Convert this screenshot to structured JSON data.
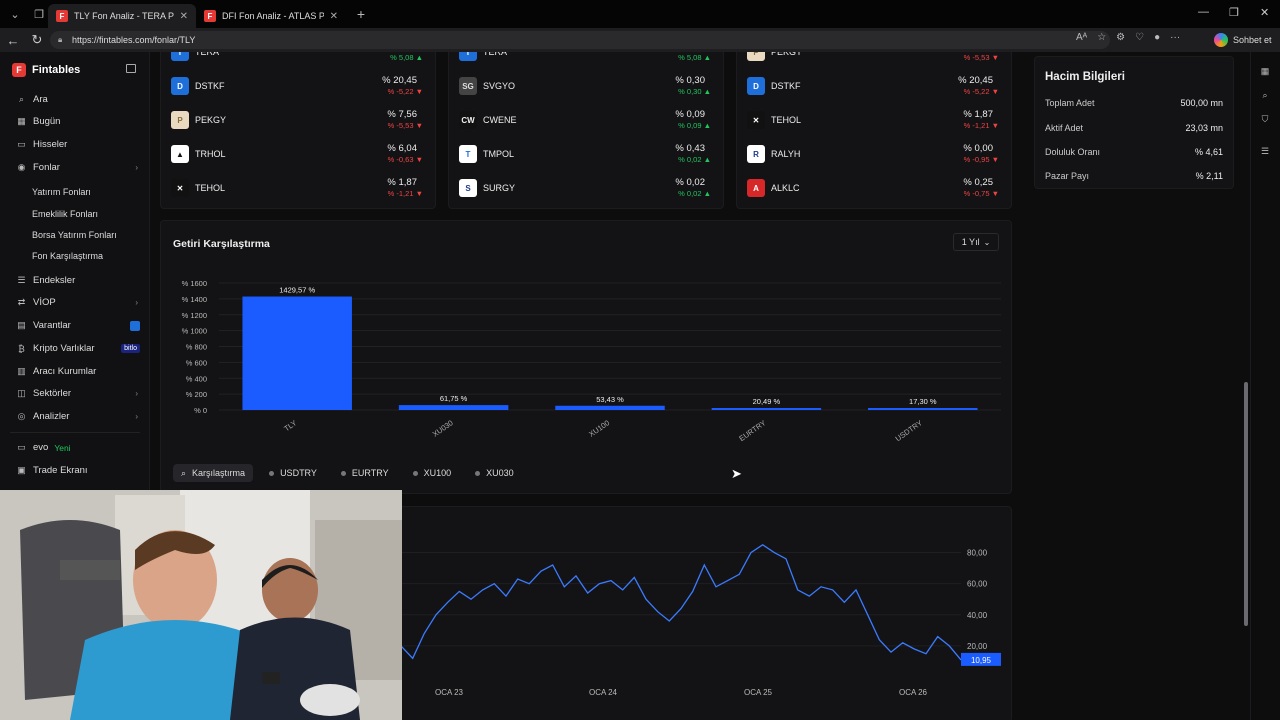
{
  "browser": {
    "tabs": [
      {
        "label": "TLY Fon Analiz - TERA PORTFÖY B"
      },
      {
        "label": "DFI Fon Analiz - ATLAS PORTFÖY"
      }
    ],
    "url": "https://fintables.com/fonlar/TLY",
    "copilot_label": "Sohbet et"
  },
  "sidebar": {
    "brand": "Fintables",
    "items": [
      {
        "label": "Ara"
      },
      {
        "label": "Bugün"
      },
      {
        "label": "Hisseler"
      },
      {
        "label": "Fonlar"
      },
      {
        "label": "Endeksler"
      },
      {
        "label": "VİOP"
      },
      {
        "label": "Varantlar"
      },
      {
        "label": "Kripto Varlıklar",
        "badge": "bitlo"
      },
      {
        "label": "Aracı Kurumlar"
      },
      {
        "label": "Sektörler"
      },
      {
        "label": "Analizler"
      },
      {
        "label": "evo",
        "badge": "Yeni"
      },
      {
        "label": "Trade Ekranı"
      }
    ],
    "fon_subitems": [
      "Yatırım Fonları",
      "Emeklilik Fonları",
      "Borsa Yatırım Fonları",
      "Fon Karşılaştırma"
    ]
  },
  "holdings": {
    "col1": [
      {
        "ticker": "TERA",
        "value": "",
        "change": "% 5,08",
        "dir": "up"
      },
      {
        "ticker": "DSTKF",
        "value": "% 20,45",
        "change": "% -5,22",
        "dir": "dn"
      },
      {
        "ticker": "PEKGY",
        "value": "% 7,56",
        "change": "% -5,53",
        "dir": "dn"
      },
      {
        "ticker": "TRHOL",
        "value": "% 6,04",
        "change": "% -0,63",
        "dir": "dn"
      },
      {
        "ticker": "TEHOL",
        "value": "% 1,87",
        "change": "% -1,21",
        "dir": "dn"
      }
    ],
    "col2": [
      {
        "ticker": "TERA",
        "value": "",
        "change": "% 5,08",
        "dir": "up"
      },
      {
        "ticker": "SVGYO",
        "value": "% 0,30",
        "change": "% 0,30",
        "dir": "up"
      },
      {
        "ticker": "CWENE",
        "value": "% 0,09",
        "change": "% 0,09",
        "dir": "up"
      },
      {
        "ticker": "TMPOL",
        "value": "% 0,43",
        "change": "% 0,02",
        "dir": "up"
      },
      {
        "ticker": "SURGY",
        "value": "% 0,02",
        "change": "% 0,02",
        "dir": "up"
      }
    ],
    "col3": [
      {
        "ticker": "PEKGY",
        "value": "",
        "change": "% -5,53",
        "dir": "dn"
      },
      {
        "ticker": "DSTKF",
        "value": "% 20,45",
        "change": "% -5,22",
        "dir": "dn"
      },
      {
        "ticker": "TEHOL",
        "value": "% 1,87",
        "change": "% -1,21",
        "dir": "dn"
      },
      {
        "ticker": "RALYH",
        "value": "% 0,00",
        "change": "% -0,95",
        "dir": "dn"
      },
      {
        "ticker": "ALKLC",
        "value": "% 0,25",
        "change": "% -0,75",
        "dir": "dn"
      }
    ]
  },
  "hacim": {
    "title": "Hacim Bilgileri",
    "rows": [
      {
        "label": "Toplam Adet",
        "value": "500,00 mn"
      },
      {
        "label": "Aktif Adet",
        "value": "23,03 mn"
      },
      {
        "label": "Doluluk Oranı",
        "value": "% 4,61"
      },
      {
        "label": "Pazar Payı",
        "value": "% 2,11"
      }
    ]
  },
  "getiri": {
    "title": "Getiri Karşılaştırma",
    "period": "1 Yıl",
    "compare_label": "Karşılaştırma",
    "compare_chips": [
      "USDTRY",
      "EURTRY",
      "XU100",
      "XU030"
    ]
  },
  "chart_data": [
    {
      "type": "bar",
      "title": "Getiri Karşılaştırma",
      "categories": [
        "TLY",
        "XU030",
        "XU100",
        "EURTRY",
        "USDTRY"
      ],
      "values": [
        1429.57,
        61.75,
        53.43,
        20.49,
        17.3
      ],
      "value_labels": [
        "1429,57 %",
        "61,75 %",
        "53,43 %",
        "20,49 %",
        "17,30 %"
      ],
      "yticks": [
        "% 1600",
        "% 1400",
        "% 1200",
        "% 1000",
        "% 800",
        "% 600",
        "% 400",
        "% 200",
        "% 0"
      ],
      "ylim": [
        0,
        1600
      ],
      "grid": true,
      "colors": [
        "#1a5cff"
      ]
    },
    {
      "type": "line",
      "x_labels": [
        "OCA 23",
        "OCA 24",
        "OCA 25",
        "OCA 26"
      ],
      "yticks": [
        "80,00",
        "60,00",
        "40,00",
        "20,00"
      ],
      "ylim": [
        0,
        90
      ],
      "last_value": "10,95",
      "approx_series": [
        20,
        12,
        28,
        40,
        48,
        55,
        50,
        56,
        60,
        52,
        63,
        60,
        68,
        72,
        58,
        65,
        54,
        60,
        62,
        56,
        64,
        50,
        42,
        36,
        44,
        55,
        72,
        58,
        62,
        66,
        80,
        85,
        80,
        76,
        56,
        52,
        58,
        56,
        48,
        56,
        40,
        24,
        16,
        22,
        18,
        15,
        26,
        20,
        11
      ],
      "colors": [
        "#3b7bff"
      ]
    }
  ]
}
